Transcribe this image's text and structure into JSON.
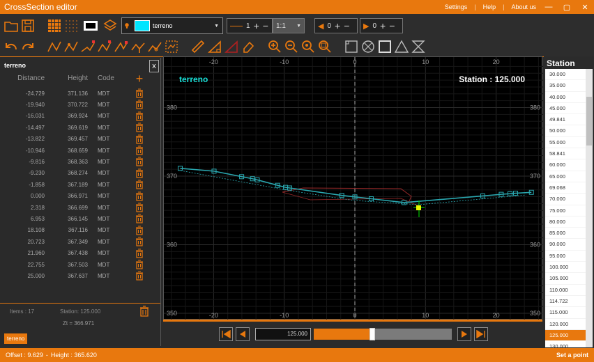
{
  "app": {
    "title": "CrossSection editor"
  },
  "titlebar": {
    "settings": "Settings",
    "help": "Help",
    "about": "About us",
    "minimize": "—",
    "maximize": "▢",
    "close": "✕"
  },
  "toolbar": {
    "layer_name": "terreno",
    "line_width": "1",
    "scale": "1:1",
    "left_offset": "0",
    "right_offset": "0",
    "swatch_color": "#00e5ff"
  },
  "left_panel": {
    "title": "terreno",
    "close": "x",
    "headers": {
      "distance": "Distance",
      "height": "Height",
      "code": "Code"
    },
    "rows": [
      {
        "d": "-24.729",
        "h": "371.136",
        "c": "MDT"
      },
      {
        "d": "-19.940",
        "h": "370.722",
        "c": "MDT"
      },
      {
        "d": "-16.031",
        "h": "369.924",
        "c": "MDT"
      },
      {
        "d": "-14.497",
        "h": "369.619",
        "c": "MDT"
      },
      {
        "d": "-13.822",
        "h": "369.457",
        "c": "MDT"
      },
      {
        "d": "-10.946",
        "h": "368.659",
        "c": "MDT"
      },
      {
        "d": "-9.816",
        "h": "368.363",
        "c": "MDT"
      },
      {
        "d": "-9.230",
        "h": "368.274",
        "c": "MDT"
      },
      {
        "d": "-1.858",
        "h": "367.189",
        "c": "MDT"
      },
      {
        "d": "0.000",
        "h": "366.971",
        "c": "MDT"
      },
      {
        "d": "2.318",
        "h": "366.699",
        "c": "MDT"
      },
      {
        "d": "6.953",
        "h": "366.145",
        "c": "MDT"
      },
      {
        "d": "18.108",
        "h": "367.116",
        "c": "MDT"
      },
      {
        "d": "20.723",
        "h": "367.349",
        "c": "MDT"
      },
      {
        "d": "21.960",
        "h": "367.438",
        "c": "MDT"
      },
      {
        "d": "22.755",
        "h": "367.503",
        "c": "MDT"
      },
      {
        "d": "25.000",
        "h": "367.637",
        "c": "MDT"
      }
    ],
    "items": "Items : 17",
    "station": "Station: 125.000",
    "zt": "Zt = 366.971",
    "tag": "terreno"
  },
  "canvas": {
    "layer_label": "terreno",
    "station_label": "Station : 125.000",
    "x_ticks": [
      "-20",
      "-10",
      "0",
      "10",
      "20"
    ],
    "y_ticks": [
      "380",
      "370",
      "360",
      "350"
    ]
  },
  "nav": {
    "station_value": "125.000",
    "progress": 0.2
  },
  "station_panel": {
    "title": "Station",
    "items": [
      "30.000",
      "35.000",
      "40.000",
      "45.000",
      "49.841",
      "50.000",
      "55.000",
      "58.841",
      "60.000",
      "65.000",
      "69.068",
      "70.000",
      "75.000",
      "80.000",
      "85.000",
      "90.000",
      "95.000",
      "100.000",
      "105.000",
      "110.000",
      "114.722",
      "115.000",
      "120.000",
      "125.000",
      "130.000"
    ],
    "selected_index": 23
  },
  "status": {
    "offset": "Offset : 9.629",
    "height": "Height : 365.620",
    "action": "Set a point"
  }
}
